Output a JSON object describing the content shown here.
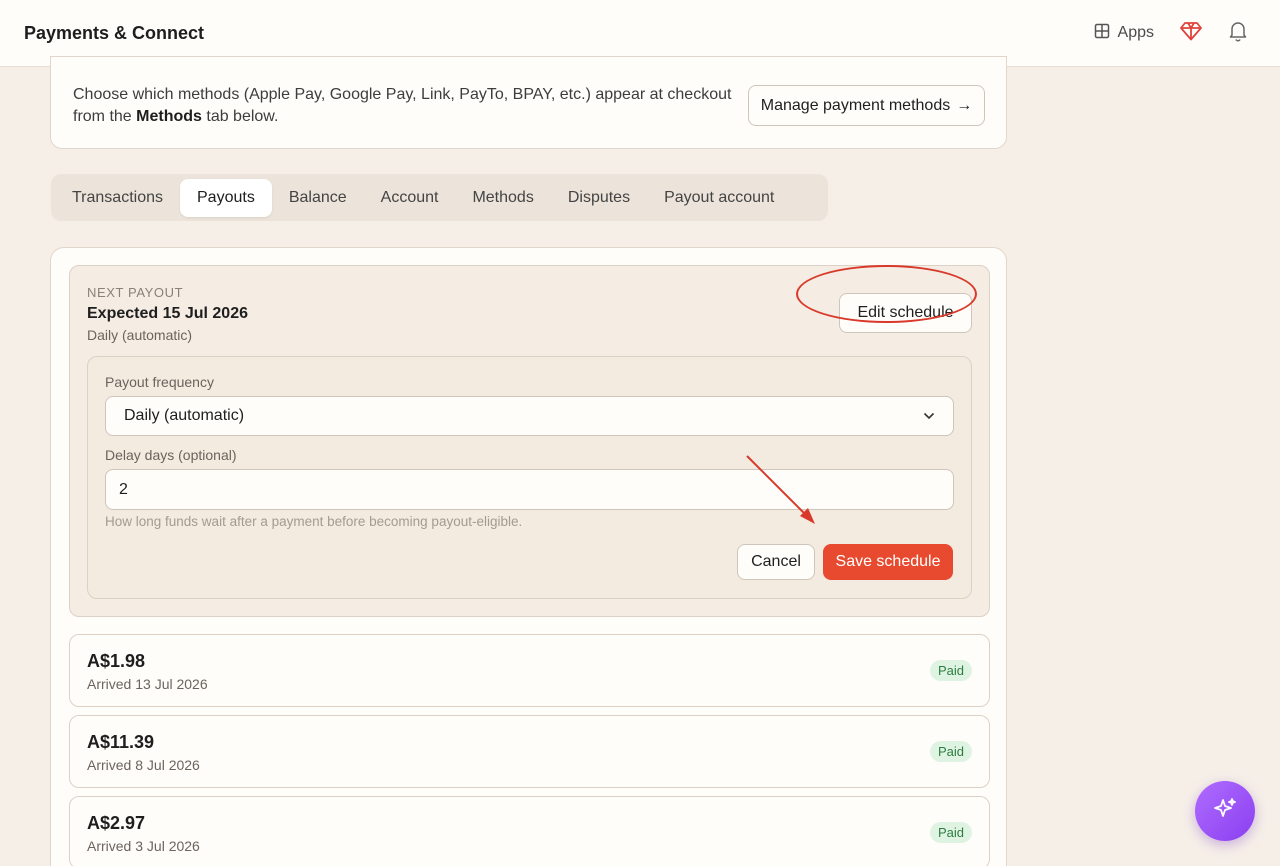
{
  "header": {
    "title": "Payments & Connect",
    "apps_label": "Apps"
  },
  "methods_card": {
    "text_before": "Choose which methods (Apple Pay, Google Pay, Link, PayTo, BPAY, etc.) appear at checkout from the ",
    "text_bold": "Methods",
    "text_after": " tab below.",
    "manage_button_label": "Manage payment methods",
    "manage_button_arrow": "→"
  },
  "tabs": [
    {
      "label": "Transactions",
      "active": false
    },
    {
      "label": "Payouts",
      "active": true
    },
    {
      "label": "Balance",
      "active": false
    },
    {
      "label": "Account",
      "active": false
    },
    {
      "label": "Methods",
      "active": false
    },
    {
      "label": "Disputes",
      "active": false
    },
    {
      "label": "Payout account",
      "active": false
    }
  ],
  "next_payout": {
    "section_label": "NEXT PAYOUT",
    "expected": "Expected 15 Jul 2026",
    "mode": "Daily (automatic)",
    "edit_button_label": "Edit schedule"
  },
  "schedule_form": {
    "frequency_label": "Payout frequency",
    "frequency_value": "Daily (automatic)",
    "delay_label": "Delay days (optional)",
    "delay_value": "2",
    "hint": "How long funds wait after a payment before becoming payout-eligible.",
    "cancel_label": "Cancel",
    "save_label": "Save schedule"
  },
  "payouts": [
    {
      "amount": "A$1.98",
      "arrived": "Arrived 13 Jul 2026",
      "status": "Paid"
    },
    {
      "amount": "A$11.39",
      "arrived": "Arrived 8 Jul 2026",
      "status": "Paid"
    },
    {
      "amount": "A$2.97",
      "arrived": "Arrived 3 Jul 2026",
      "status": "Paid"
    }
  ],
  "icons": {
    "apps": "grid-icon",
    "premium": "gem-icon",
    "notifications": "bell-icon",
    "assistant": "sparkle-icon",
    "select_chevron": "chevron-down-icon"
  },
  "colors": {
    "accent": "#e84a2f",
    "annotation": "#d9392a",
    "gem": "#e0433a",
    "paid_bg": "#dff3e3",
    "paid_text": "#2e7d40",
    "fab": "#9b55f7"
  }
}
